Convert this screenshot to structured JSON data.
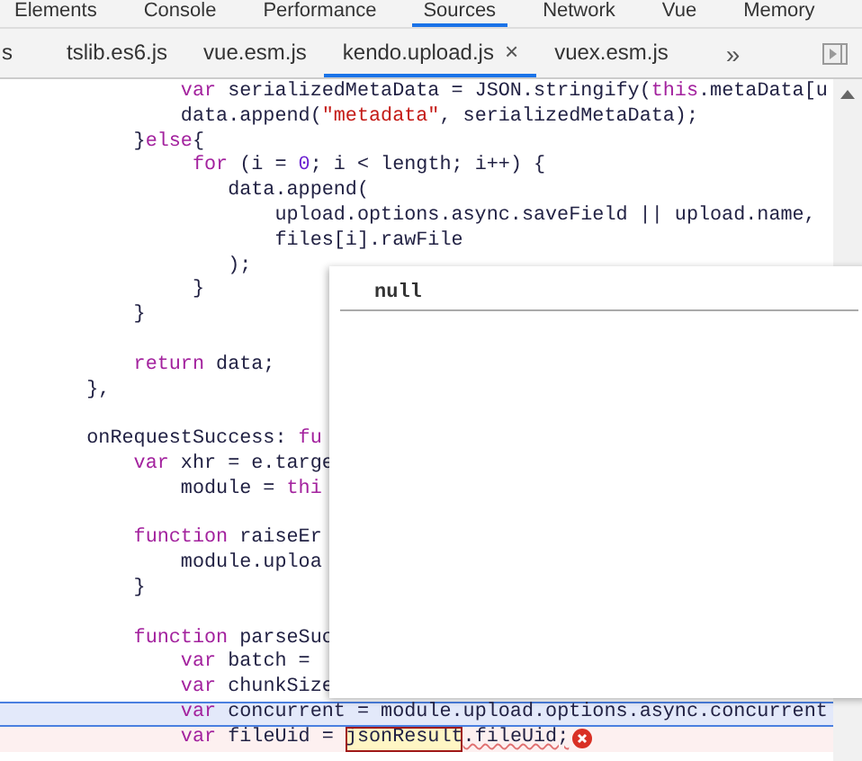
{
  "panel_tabs": [
    {
      "label": "Elements",
      "selected": false
    },
    {
      "label": "Console",
      "selected": false
    },
    {
      "label": "Performance",
      "selected": false
    },
    {
      "label": "Sources",
      "selected": true
    },
    {
      "label": "Network",
      "selected": false
    },
    {
      "label": "Vue",
      "selected": false
    },
    {
      "label": "Memory",
      "selected": false
    }
  ],
  "file_tabs": [
    {
      "label": "s",
      "selected": false
    },
    {
      "label": "tslib.es6.js",
      "selected": false
    },
    {
      "label": "vue.esm.js",
      "selected": false
    },
    {
      "label": "kendo.upload.js",
      "selected": true,
      "close": "×"
    },
    {
      "label": "vuex.esm.js",
      "selected": false
    }
  ],
  "overflow_button": "»",
  "code_lines": [
    {
      "kind": "normal",
      "segments": [
        {
          "text": "            var",
          "kind": "kw"
        },
        {
          "text": " serializedMetaData = JSON.stringify(",
          "kind": "p"
        },
        {
          "text": "this",
          "kind": "kw"
        },
        {
          "text": ".metaData[u",
          "kind": "p"
        }
      ]
    },
    {
      "kind": "normal",
      "segments": [
        {
          "text": "            data.append(",
          "kind": "p"
        },
        {
          "text": "\"metadata\"",
          "kind": "str"
        },
        {
          "text": ", serializedMetaData);",
          "kind": "p"
        }
      ]
    },
    {
      "kind": "normal",
      "segments": [
        {
          "text": "        }",
          "kind": "p"
        },
        {
          "text": "else",
          "kind": "kw"
        },
        {
          "text": "{",
          "kind": "p"
        }
      ]
    },
    {
      "kind": "normal",
      "segments": [
        {
          "text": "             for",
          "kind": "kw"
        },
        {
          "text": " (i = ",
          "kind": "p"
        },
        {
          "text": "0",
          "kind": "num"
        },
        {
          "text": "; i < length; i++) {",
          "kind": "p"
        }
      ]
    },
    {
      "kind": "normal",
      "segments": [
        {
          "text": "                data.append(",
          "kind": "p"
        }
      ]
    },
    {
      "kind": "normal",
      "segments": [
        {
          "text": "                    upload.options.async.saveField || upload.name,",
          "kind": "p"
        }
      ]
    },
    {
      "kind": "normal",
      "segments": [
        {
          "text": "                    files[i].rawFile",
          "kind": "p"
        }
      ]
    },
    {
      "kind": "normal",
      "segments": [
        {
          "text": "                );",
          "kind": "p"
        }
      ]
    },
    {
      "kind": "normal",
      "segments": [
        {
          "text": "             }",
          "kind": "p"
        }
      ]
    },
    {
      "kind": "normal",
      "segments": [
        {
          "text": "        }",
          "kind": "p"
        }
      ]
    },
    {
      "kind": "blank"
    },
    {
      "kind": "normal",
      "segments": [
        {
          "text": "        return",
          "kind": "kw"
        },
        {
          "text": " data;",
          "kind": "p"
        }
      ]
    },
    {
      "kind": "normal",
      "segments": [
        {
          "text": "    },",
          "kind": "p"
        }
      ]
    },
    {
      "kind": "blank"
    },
    {
      "kind": "normal",
      "segments": [
        {
          "text": "    onRequestSuccess: ",
          "kind": "p"
        },
        {
          "text": "fu",
          "kind": "kw"
        }
      ]
    },
    {
      "kind": "normal",
      "segments": [
        {
          "text": "        var",
          "kind": "kw"
        },
        {
          "text": " xhr = e.targe",
          "kind": "p"
        }
      ]
    },
    {
      "kind": "normal",
      "segments": [
        {
          "text": "            module = ",
          "kind": "p"
        },
        {
          "text": "thi",
          "kind": "kw"
        }
      ]
    },
    {
      "kind": "blank"
    },
    {
      "kind": "normal",
      "segments": [
        {
          "text": "        function",
          "kind": "kw"
        },
        {
          "text": " raiseEr",
          "kind": "p"
        }
      ]
    },
    {
      "kind": "normal",
      "segments": [
        {
          "text": "            module.uploa",
          "kind": "p"
        }
      ]
    },
    {
      "kind": "normal",
      "segments": [
        {
          "text": "        }",
          "kind": "p"
        }
      ]
    },
    {
      "kind": "blank"
    },
    {
      "kind": "normal",
      "segments": [
        {
          "text": "        function",
          "kind": "kw"
        },
        {
          "text": " parseSuc",
          "kind": "p"
        }
      ]
    },
    {
      "kind": "normal",
      "segments": [
        {
          "text": "            var",
          "kind": "kw"
        },
        {
          "text": " batch =",
          "kind": "p"
        }
      ]
    },
    {
      "kind": "normal",
      "segments": [
        {
          "text": "            var",
          "kind": "kw"
        },
        {
          "text": " chunkSize",
          "kind": "p"
        }
      ]
    },
    {
      "kind": "selected",
      "segments": [
        {
          "text": "            var",
          "kind": "kw"
        },
        {
          "text": " concurrent = module.upload.options.async.concurrent",
          "kind": "p"
        }
      ]
    },
    {
      "kind": "error",
      "segments": [
        {
          "text": "            var",
          "kind": "kw"
        },
        {
          "text": " fileUid = ",
          "kind": "p"
        },
        {
          "text": "jsonResult",
          "kind": "match"
        },
        {
          "text": ".fileUid;",
          "kind": "squiggle"
        }
      ]
    }
  ],
  "popup": {
    "value": "null"
  }
}
